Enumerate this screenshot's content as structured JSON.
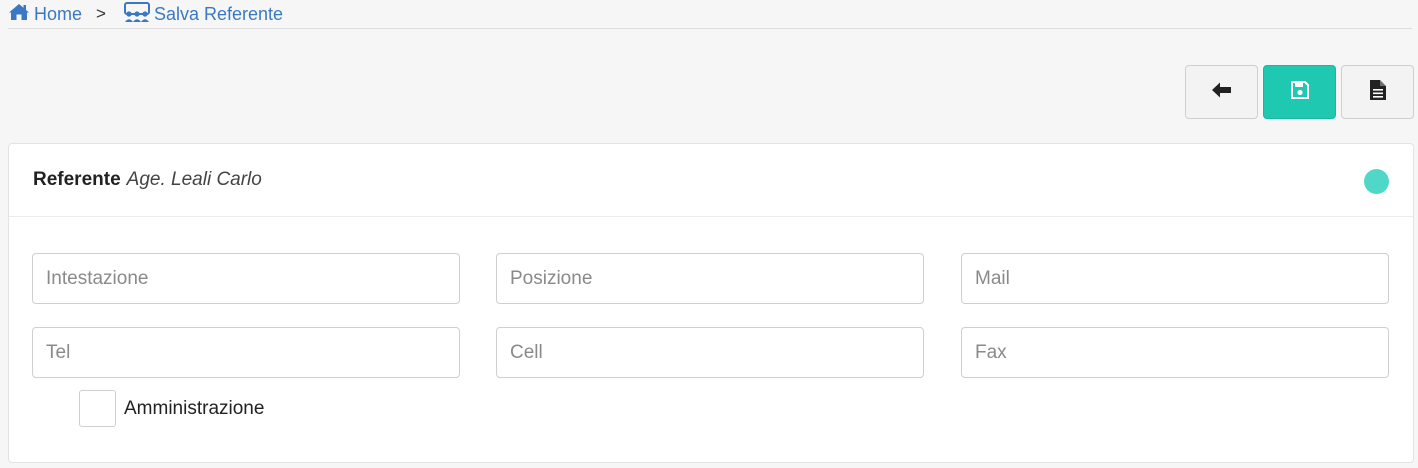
{
  "breadcrumb": {
    "home_label": "Home",
    "separator": ">",
    "current_label": "Salva Referente",
    "home_icon": "home-icon",
    "current_icon": "users-icon"
  },
  "toolbar": {
    "back_icon": "arrow-left-icon",
    "save_icon": "floppy-disk-icon",
    "document_icon": "document-icon",
    "save_color": "#1ec8b1"
  },
  "card": {
    "title_label": "Referente",
    "title_name": "Age. Leali Carlo",
    "status_color": "#4fd8c8"
  },
  "form": {
    "intestazione": {
      "placeholder": "Intestazione",
      "value": ""
    },
    "posizione": {
      "placeholder": "Posizione",
      "value": ""
    },
    "mail": {
      "placeholder": "Mail",
      "value": ""
    },
    "tel": {
      "placeholder": "Tel",
      "value": ""
    },
    "cell": {
      "placeholder": "Cell",
      "value": ""
    },
    "fax": {
      "placeholder": "Fax",
      "value": ""
    },
    "amministrazione_label": "Amministrazione",
    "amministrazione_checked": false
  }
}
